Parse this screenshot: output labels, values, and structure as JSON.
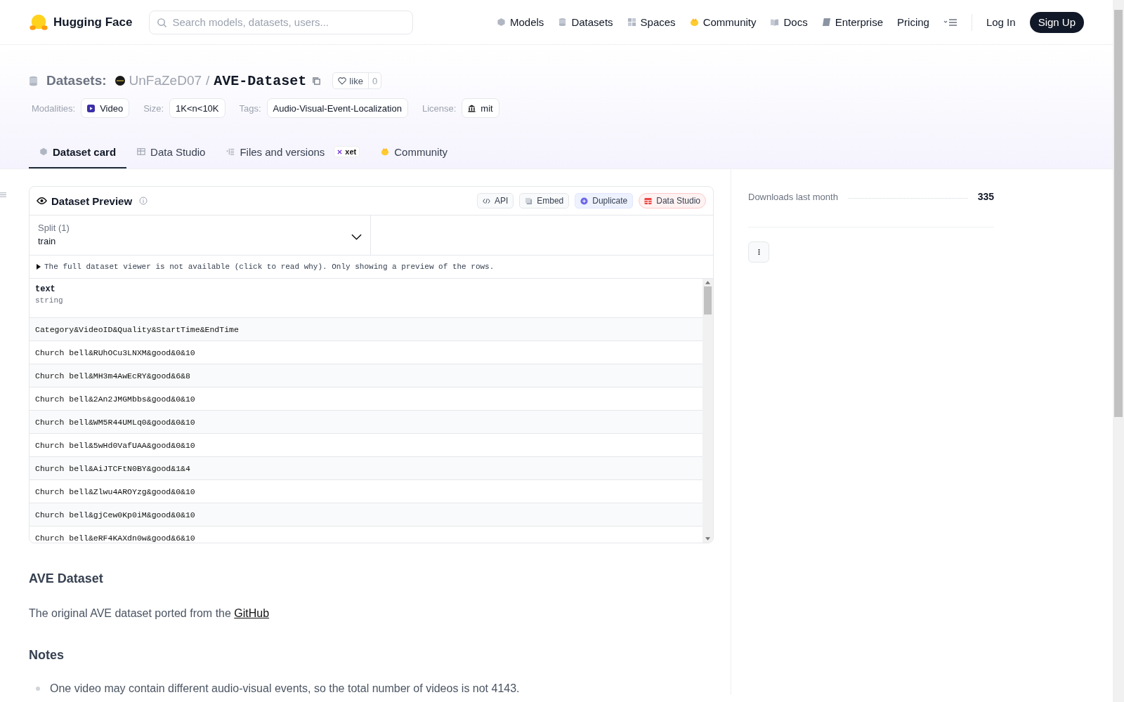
{
  "nav": {
    "brand": "Hugging Face",
    "search": {
      "placeholder": "Search models, datasets, users..."
    },
    "links": [
      {
        "label": "Models",
        "kind": "models"
      },
      {
        "label": "Datasets",
        "kind": "datasets"
      },
      {
        "label": "Spaces",
        "kind": "spaces"
      },
      {
        "label": "Community",
        "kind": "community"
      },
      {
        "label": "Docs",
        "kind": "docs"
      },
      {
        "label": "Enterprise",
        "kind": "enterprise"
      },
      {
        "label": "Pricing",
        "kind": "plain"
      }
    ],
    "log_in": "Log In",
    "sign_up": "Sign Up"
  },
  "header": {
    "section": "Datasets:",
    "owner": "UnFaZeD07",
    "separator": "/",
    "name": "AVE-Dataset",
    "like": {
      "label": "like",
      "count": "0"
    },
    "meta": [
      {
        "label": "Modalities:",
        "value": "Video",
        "kind": "video"
      },
      {
        "label": "Size:",
        "value": "1K<n<10K",
        "kind": "plain"
      },
      {
        "label": "Tags:",
        "value": "Audio-Visual-Event-Localization",
        "kind": "plain"
      },
      {
        "label": "License:",
        "value": "mit",
        "kind": "license"
      }
    ]
  },
  "tabs": [
    {
      "label": "Dataset card",
      "kind": "card",
      "selected": true
    },
    {
      "label": "Data Studio",
      "kind": "studio",
      "selected": false
    },
    {
      "label": "Files and versions",
      "kind": "files",
      "badge": "xet",
      "selected": false
    },
    {
      "label": "Community",
      "kind": "community",
      "selected": false
    }
  ],
  "preview": {
    "title": "Dataset Preview",
    "actions": [
      {
        "label": "API",
        "kind": "api"
      },
      {
        "label": "Embed",
        "kind": "embed"
      },
      {
        "label": "Duplicate",
        "kind": "duplicate"
      },
      {
        "label": "Data Studio",
        "kind": "studio"
      }
    ],
    "split": {
      "label": "Split (1)",
      "value": "train"
    },
    "notice": "The full dataset viewer is not available (click to read why). Only showing a preview of the rows.",
    "column": {
      "name": "text",
      "type": "string"
    },
    "rows": [
      "Category&VideoID&Quality&StartTime&EndTime",
      "Church bell&RUhOCu3LNXM&good&0&10",
      "Church bell&MH3m4AwEcRY&good&6&8",
      "Church bell&2An2JMGMbbs&good&0&10",
      "Church bell&WM5R44UMLq0&good&0&10",
      "Church bell&5wHd0VafUAA&good&0&10",
      "Church bell&AiJTCFtN0BY&good&1&4",
      "Church bell&Zlwu4AROYzg&good&0&10",
      "Church bell&gjCew0Kp0iM&good&0&10",
      "Church bell&eRF4KAXdn0w&good&6&10"
    ]
  },
  "sidebar": {
    "downloads_label": "Downloads last month",
    "downloads_value": "335"
  },
  "readme": {
    "title": "AVE Dataset",
    "intro": "The original AVE dataset ported from the ",
    "link": "GitHub",
    "notes_title": "Notes",
    "bullets": [
      "One video may contain different audio-visual events, so the total number of videos is not 4143."
    ]
  }
}
